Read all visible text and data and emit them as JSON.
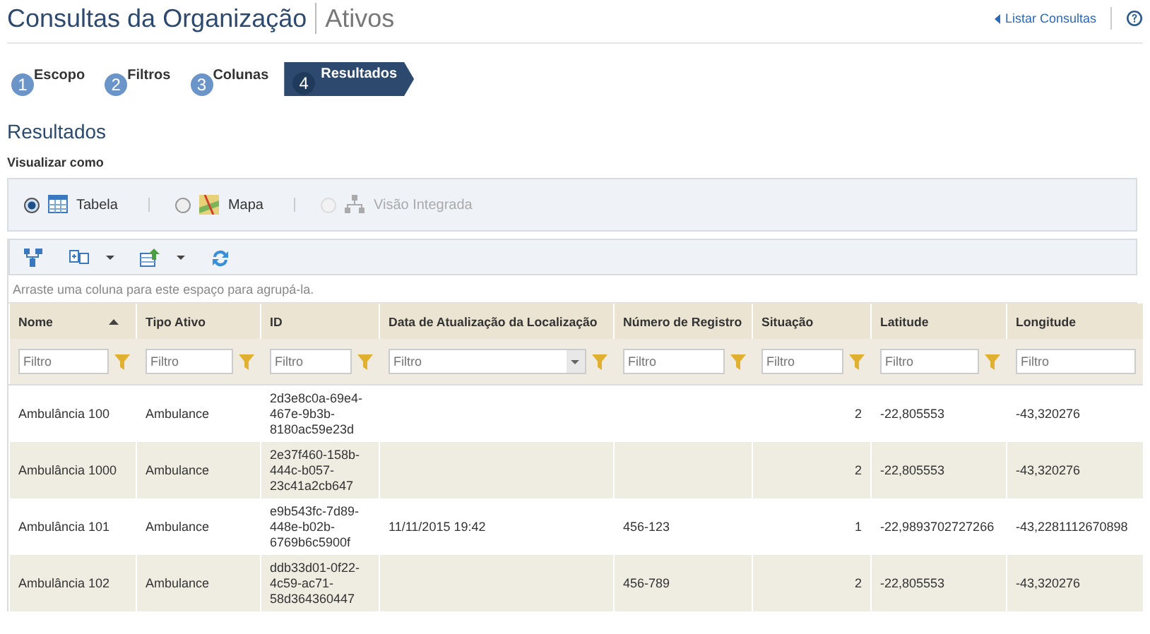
{
  "header": {
    "title": "Consultas da Organização",
    "subtitle": "Ativos",
    "link": "Listar Consultas"
  },
  "steps": [
    {
      "number": "1",
      "label": "Escopo",
      "selected": false
    },
    {
      "number": "2",
      "label": "Filtros",
      "selected": false
    },
    {
      "number": "3",
      "label": "Colunas",
      "selected": false
    },
    {
      "number": "4",
      "label": "Resultados",
      "selected": true
    }
  ],
  "section_title": "Resultados",
  "view_as": {
    "label": "Visualizar como",
    "options": [
      {
        "label": "Tabela",
        "kind": "table",
        "selected": true,
        "disabled": false
      },
      {
        "label": "Mapa",
        "kind": "map",
        "selected": false,
        "disabled": false
      },
      {
        "label": "Visão Integrada",
        "kind": "hierarchy",
        "selected": false,
        "disabled": true
      }
    ]
  },
  "toolbar": [
    {
      "kind": "structure",
      "dropdown": false
    },
    {
      "kind": "group",
      "dropdown": true
    },
    {
      "kind": "export",
      "dropdown": true
    },
    {
      "kind": "refresh",
      "dropdown": false
    }
  ],
  "group_panel": "Arraste uma coluna para este espaço para agrupá-la.",
  "table": {
    "columns": [
      {
        "label": "Nome",
        "sorted_ascending": true,
        "filter": {
          "placeholder": "Filtro",
          "kind": "text",
          "funnel": true
        }
      },
      {
        "label": "Tipo Ativo",
        "filter": {
          "placeholder": "Filtro",
          "kind": "text",
          "funnel": true
        }
      },
      {
        "label": "ID",
        "filter": {
          "placeholder": "Filtro",
          "kind": "text",
          "funnel": true
        }
      },
      {
        "label": "Data de Atualização da Localização",
        "filter": {
          "placeholder": "Filtro",
          "kind": "dropdown",
          "funnel": true
        }
      },
      {
        "label": "Número de Registro",
        "filter": {
          "placeholder": "Filtro",
          "kind": "text",
          "funnel": true
        }
      },
      {
        "label": "Situação",
        "right_aligned": true,
        "filter": {
          "placeholder": "Filtro",
          "kind": "text",
          "funnel": true
        }
      },
      {
        "label": "Latitude",
        "filter": {
          "placeholder": "Filtro",
          "kind": "text",
          "funnel": true
        }
      },
      {
        "label": "Longitude",
        "filter": {
          "placeholder": "Filtro",
          "kind": "text",
          "funnel": false
        }
      }
    ],
    "rows": [
      [
        "Ambulância 100",
        "Ambulance",
        "2d3e8c0a-69e4-467e-9b3b-8180ac59e23d",
        "",
        "",
        "2",
        "-22,805553",
        "-43,320276"
      ],
      [
        "Ambulância 1000",
        "Ambulance",
        "2e37f460-158b-444c-b057-23c41a2cb647",
        "",
        "",
        "2",
        "-22,805553",
        "-43,320276"
      ],
      [
        "Ambulância 101",
        "Ambulance",
        "e9b543fc-7d89-448e-b02b-6769b6c5900f",
        "11/11/2015 19:42",
        "456-123",
        "1",
        "-22,9893702727266",
        "-43,2281112670898"
      ],
      [
        "Ambulância 102",
        "Ambulance",
        "ddb33d01-0f22-4c59-ac71-58d364360447",
        "",
        "456-789",
        "2",
        "-22,805553",
        "-43,320276"
      ]
    ]
  }
}
